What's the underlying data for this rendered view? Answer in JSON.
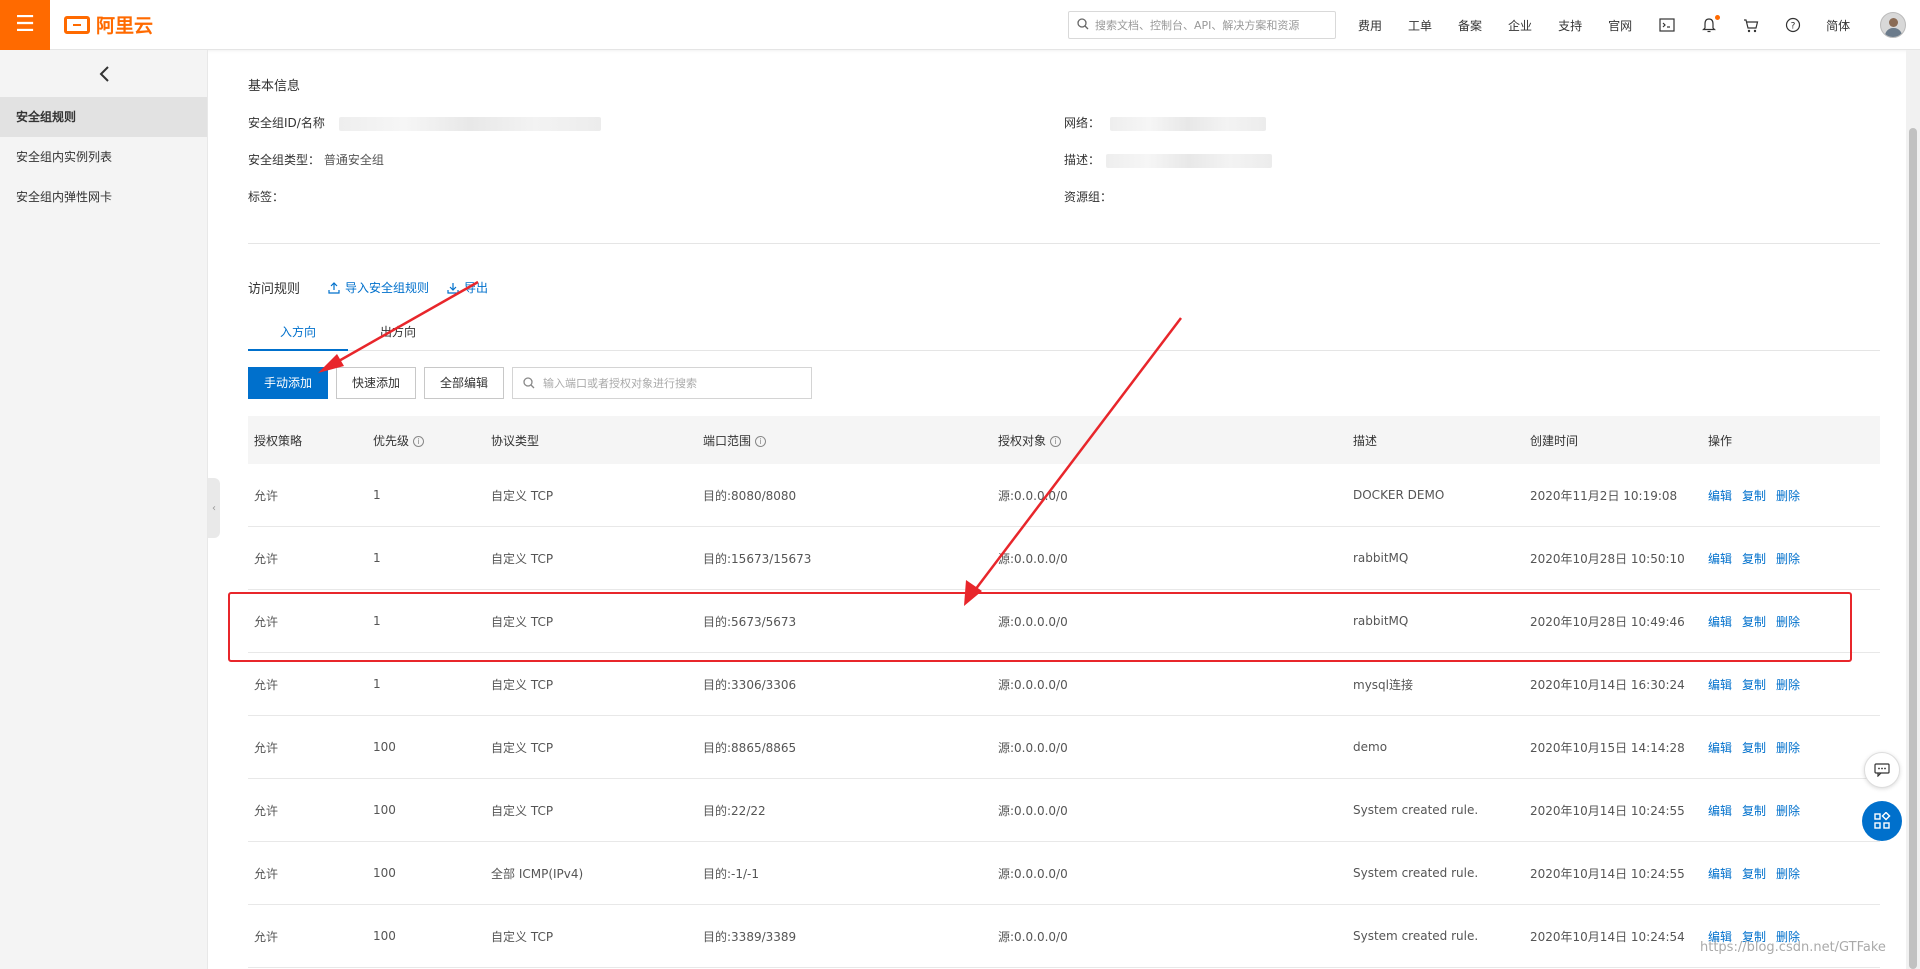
{
  "header": {
    "menu_icon": "hamburger-icon",
    "logo_text": "阿里云",
    "search_placeholder": "搜索文档、控制台、API、解决方案和资源",
    "nav": [
      "费用",
      "工单",
      "备案",
      "企业",
      "支持",
      "官网"
    ],
    "lang": "简体",
    "icons": [
      "terminal-icon",
      "bell-icon",
      "cart-icon",
      "help-icon"
    ]
  },
  "sidebar": {
    "back_icon": "chevron-left-icon",
    "items": [
      {
        "label": "安全组规则",
        "active": true
      },
      {
        "label": "安全组内实例列表",
        "active": false
      },
      {
        "label": "安全组内弹性网卡",
        "active": false
      }
    ]
  },
  "basic_info": {
    "title": "基本信息",
    "id_label": "安全组ID/名称",
    "type_label": "安全组类型：",
    "type_value": "普通安全组",
    "tags_label": "标签：",
    "network_label": "网络：",
    "desc_label": "描述：",
    "resource_group_label": "资源组："
  },
  "rules": {
    "title": "访问规则",
    "import_label": "导入安全组规则",
    "export_label": "导出",
    "tabs": [
      {
        "label": "入方向",
        "active": true
      },
      {
        "label": "出方向",
        "active": false
      }
    ],
    "buttons": {
      "manual_add": "手动添加",
      "quick_add": "快速添加",
      "edit_all": "全部编辑"
    },
    "search_placeholder": "输入端口或者授权对象进行搜索",
    "columns": [
      "授权策略",
      "优先级",
      "协议类型",
      "端口范围",
      "授权对象",
      "描述",
      "创建时间",
      "操作"
    ],
    "rows": [
      {
        "policy": "允许",
        "priority": "1",
        "protocol": "自定义 TCP",
        "port": "目的:8080/8080",
        "target": "源:0.0.0.0/0",
        "desc": "DOCKER DEMO",
        "time": "2020年11月2日 10:19:08"
      },
      {
        "policy": "允许",
        "priority": "1",
        "protocol": "自定义 TCP",
        "port": "目的:15673/15673",
        "target": "源:0.0.0.0/0",
        "desc": "rabbitMQ",
        "time": "2020年10月28日 10:50:10"
      },
      {
        "policy": "允许",
        "priority": "1",
        "protocol": "自定义 TCP",
        "port": "目的:5673/5673",
        "target": "源:0.0.0.0/0",
        "desc": "rabbitMQ",
        "time": "2020年10月28日 10:49:46"
      },
      {
        "policy": "允许",
        "priority": "1",
        "protocol": "自定义 TCP",
        "port": "目的:3306/3306",
        "target": "源:0.0.0.0/0",
        "desc": "mysql连接",
        "time": "2020年10月14日 16:30:24"
      },
      {
        "policy": "允许",
        "priority": "100",
        "protocol": "自定义 TCP",
        "port": "目的:8865/8865",
        "target": "源:0.0.0.0/0",
        "desc": "demo",
        "time": "2020年10月15日 14:14:28"
      },
      {
        "policy": "允许",
        "priority": "100",
        "protocol": "自定义 TCP",
        "port": "目的:22/22",
        "target": "源:0.0.0.0/0",
        "desc": "System created rule.",
        "time": "2020年10月14日 10:24:55"
      },
      {
        "policy": "允许",
        "priority": "100",
        "protocol": "全部 ICMP(IPv4)",
        "port": "目的:-1/-1",
        "target": "源:0.0.0.0/0",
        "desc": "System created rule.",
        "time": "2020年10月14日 10:24:55"
      },
      {
        "policy": "允许",
        "priority": "100",
        "protocol": "自定义 TCP",
        "port": "目的:3389/3389",
        "target": "源:0.0.0.0/0",
        "desc": "System created rule.",
        "time": "2020年10月14日 10:24:54"
      }
    ],
    "ops": [
      "编辑",
      "复制",
      "删除"
    ]
  },
  "watermark": "https://blog.csdn.net/GTFake",
  "colors": {
    "brand": "#ff6a00",
    "link": "#0070cc",
    "annotation": "#e8262b"
  }
}
